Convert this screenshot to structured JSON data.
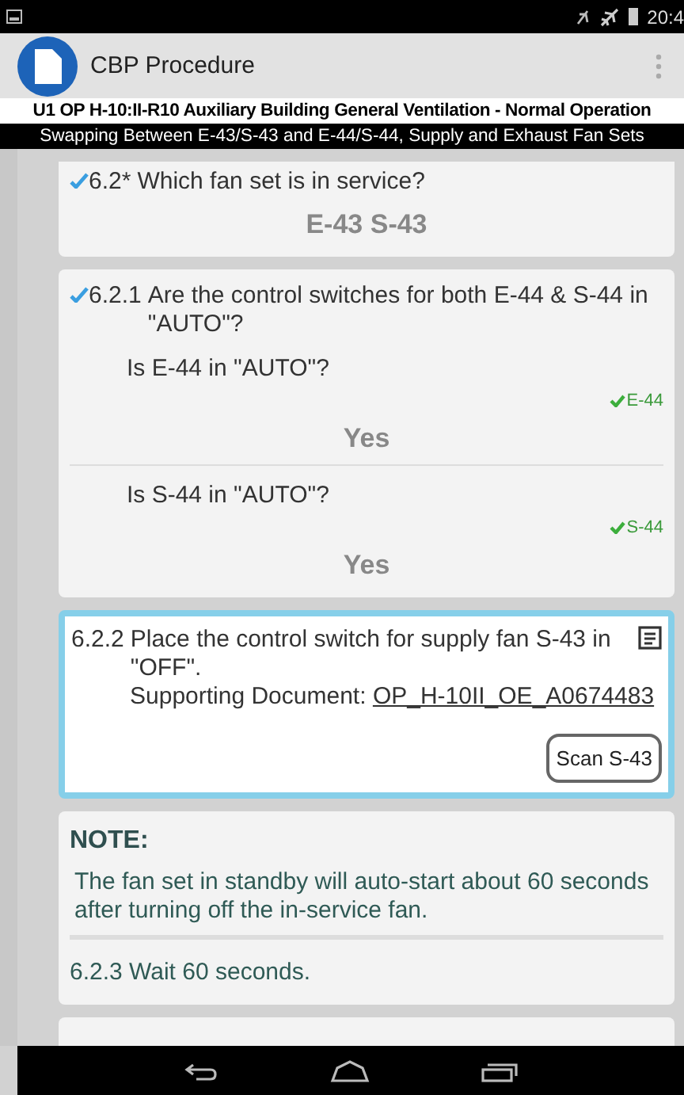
{
  "status_bar": {
    "time": "20:4"
  },
  "app_bar": {
    "title": "CBP Procedure"
  },
  "procedure": {
    "title": "U1 OP H-10:II-R10 Auxiliary Building General Ventilation - Normal Operation",
    "subtitle": "Swapping Between E-43/S-43 and E-44/S-44, Supply and Exhaust Fan Sets"
  },
  "steps": [
    {
      "kind": "question",
      "completed": true,
      "number": "6.2*",
      "text": "Which fan set is in service?",
      "answer": "E-43 S-43"
    },
    {
      "kind": "checks",
      "completed": true,
      "number": "6.2.1",
      "text": "Are the control switches for both E-44 & S-44 in \"AUTO\"?",
      "checks": [
        {
          "question": "Is E-44 in \"AUTO\"?",
          "verified": true,
          "tag": "E-44",
          "answer": "Yes"
        },
        {
          "question": "Is S-44 in \"AUTO\"?",
          "verified": true,
          "tag": "S-44",
          "answer": "Yes"
        }
      ]
    },
    {
      "kind": "action",
      "completed": false,
      "selected": true,
      "number": "6.2.2",
      "text": "Place the control switch for supply fan S-43 in \"OFF\".",
      "doc_label": "Supporting Document:",
      "doc_link": "OP_H-10II_OE_A0674483",
      "button": "Scan S-43"
    },
    {
      "kind": "note",
      "heading": "NOTE:",
      "text": "The fan set in standby will auto-start about 60 seconds after turning off the in-service fan.",
      "next_step": "6.2.3 Wait 60 seconds."
    }
  ]
}
